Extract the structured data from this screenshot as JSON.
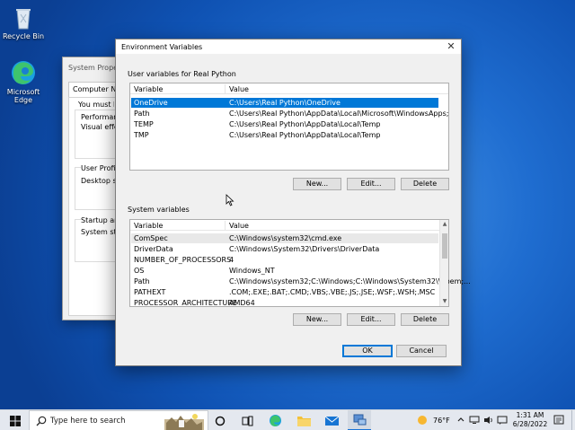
{
  "desktop": {
    "icons": [
      {
        "label": "Recycle Bin",
        "icon": "recycle-bin-icon"
      },
      {
        "label": "Microsoft Edge",
        "icon": "edge-icon"
      }
    ]
  },
  "background_window": {
    "title": "System Propert",
    "tab": "Computer Name",
    "lines": [
      "You must be lo",
      "Performance",
      "Visual effects",
      "User Profiles",
      "Desktop setti",
      "Startup and R",
      "System startu"
    ]
  },
  "dialog": {
    "title": "Environment Variables",
    "close_icon": "close-icon",
    "user_section": {
      "label": "User variables for Real Python",
      "columns": [
        "Variable",
        "Value"
      ],
      "rows": [
        {
          "variable": "OneDrive",
          "value": "C:\\Users\\Real Python\\OneDrive",
          "selected": true
        },
        {
          "variable": "Path",
          "value": "C:\\Users\\Real Python\\AppData\\Local\\Microsoft\\WindowsApps;",
          "selected": false
        },
        {
          "variable": "TEMP",
          "value": "C:\\Users\\Real Python\\AppData\\Local\\Temp",
          "selected": false
        },
        {
          "variable": "TMP",
          "value": "C:\\Users\\Real Python\\AppData\\Local\\Temp",
          "selected": false
        }
      ],
      "buttons": {
        "new": "New...",
        "edit": "Edit...",
        "delete": "Delete"
      }
    },
    "system_section": {
      "label": "System variables",
      "columns": [
        "Variable",
        "Value"
      ],
      "rows": [
        {
          "variable": "ComSpec",
          "value": "C:\\Windows\\system32\\cmd.exe"
        },
        {
          "variable": "DriverData",
          "value": "C:\\Windows\\System32\\Drivers\\DriverData"
        },
        {
          "variable": "NUMBER_OF_PROCESSORS",
          "value": "4"
        },
        {
          "variable": "OS",
          "value": "Windows_NT"
        },
        {
          "variable": "Path",
          "value": "C:\\Windows\\system32;C:\\Windows;C:\\Windows\\System32\\Wbem;..."
        },
        {
          "variable": "PATHEXT",
          "value": ".COM;.EXE;.BAT;.CMD;.VBS;.VBE;.JS;.JSE;.WSF;.WSH;.MSC"
        },
        {
          "variable": "PROCESSOR_ARCHITECTURE",
          "value": "AMD64"
        }
      ],
      "buttons": {
        "new": "New...",
        "edit": "Edit...",
        "delete": "Delete"
      }
    },
    "footer": {
      "ok": "OK",
      "cancel": "Cancel"
    }
  },
  "taskbar": {
    "search_placeholder": "Type here to search",
    "icons": [
      "windows-start-icon",
      "search-icon",
      "cortana-icon",
      "task-view-icon",
      "edge-icon",
      "file-explorer-icon",
      "mail-icon",
      "system-properties-icon"
    ],
    "weather": {
      "temp": "76°F",
      "icon": "sun-icon"
    },
    "tray_icons": [
      "chevron-up-icon",
      "network-icon",
      "volume-icon",
      "message-icon"
    ],
    "time": "1:31 AM",
    "date": "6/28/2022",
    "notification_icon": "notification-icon"
  },
  "colors": {
    "selection": "#0078d7",
    "desktop": "#1f6dd0",
    "dialog_bg": "#f0f0f0"
  }
}
